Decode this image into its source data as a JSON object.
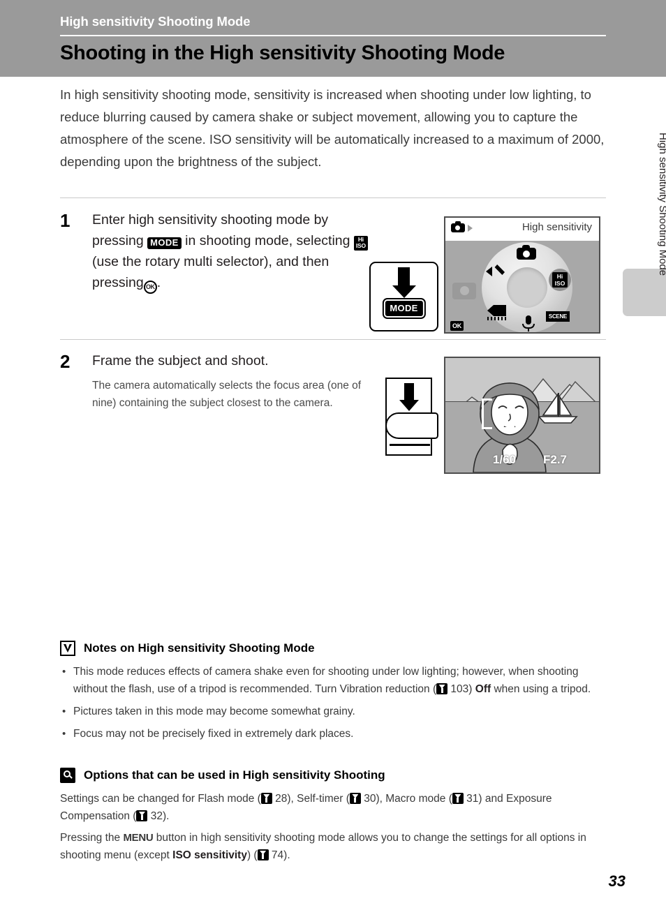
{
  "header": {
    "kicker": "High sensitivity Shooting Mode",
    "title": "Shooting in the High sensitivity Shooting Mode"
  },
  "side_tab": {
    "label": "High sensitivity Shooting Mode"
  },
  "intro": "In high sensitivity shooting mode, sensitivity is increased when shooting under low lighting, to reduce blurring caused by camera shake or subject movement, allowing you to capture the atmosphere of the scene. ISO sensitivity will be automatically increased to a maximum of 2000, depending upon the brightness of the subject.",
  "steps": [
    {
      "number": "1",
      "text_part1": "Enter high sensitivity shooting mode by pressing",
      "icon_mode": "MODE",
      "text_part2": "in shooting mode, selecting",
      "icon_hi": "Hi",
      "icon_iso": "ISO",
      "text_part3": "(use the rotary multi selector), and then pressing",
      "icon_ok": "OK",
      "text_part4": "."
    },
    {
      "number": "2",
      "heading": "Frame the subject and shoot.",
      "sub": "The camera automatically selects the focus area (one of nine) containing the subject closest to the camera."
    }
  ],
  "figures": {
    "mode_button_label": "MODE",
    "camera_screen": {
      "mode_label": "High sensitivity",
      "ok_label": "OK",
      "dial_icons": [
        "camera",
        "hi-iso",
        "scene",
        "microphone",
        "movie",
        "setup-wrench"
      ],
      "selected": "hi-iso"
    },
    "scene_screen": {
      "shutter_speed": "1/60",
      "aperture": "F2.7"
    }
  },
  "notes": {
    "title": "Notes on High sensitivity Shooting Mode",
    "bullets": [
      {
        "part1": "This mode reduces effects of camera shake even for shooting under low lighting; however, when shooting without the flash, use of a tripod is recommended. Turn Vibration reduction (",
        "ref": "103",
        "part2": ") ",
        "bold": "Off",
        "part3": " when using a tripod."
      },
      {
        "part1": "Pictures taken in this mode may become somewhat grainy."
      },
      {
        "part1": "Focus may not be precisely fixed in extremely dark places."
      }
    ]
  },
  "options": {
    "title": "Options that can be used in High sensitivity Shooting",
    "para1_a": "Settings can be changed for Flash mode (",
    "ref1": "28",
    "para1_b": "), Self-timer (",
    "ref2": "30",
    "para1_c": "), Macro mode (",
    "ref3": "31",
    "para1_d": ") and Exposure Compensation (",
    "ref4": "32",
    "para1_e": ").",
    "para2_a": "Pressing the",
    "menu_label": "MENU",
    "para2_b": "button in high sensitivity shooting mode allows you to change the settings for all options in shooting menu (except",
    "bold_term": "ISO sensitivity",
    "para2_c": ") (",
    "ref5": "74",
    "para2_d": ")."
  },
  "page_number": "33",
  "colors": {
    "header_band": "#9a9a9a",
    "side_tab": "#cccccc",
    "rule": "#c9c9c9",
    "body_text": "#3a3a3a"
  }
}
